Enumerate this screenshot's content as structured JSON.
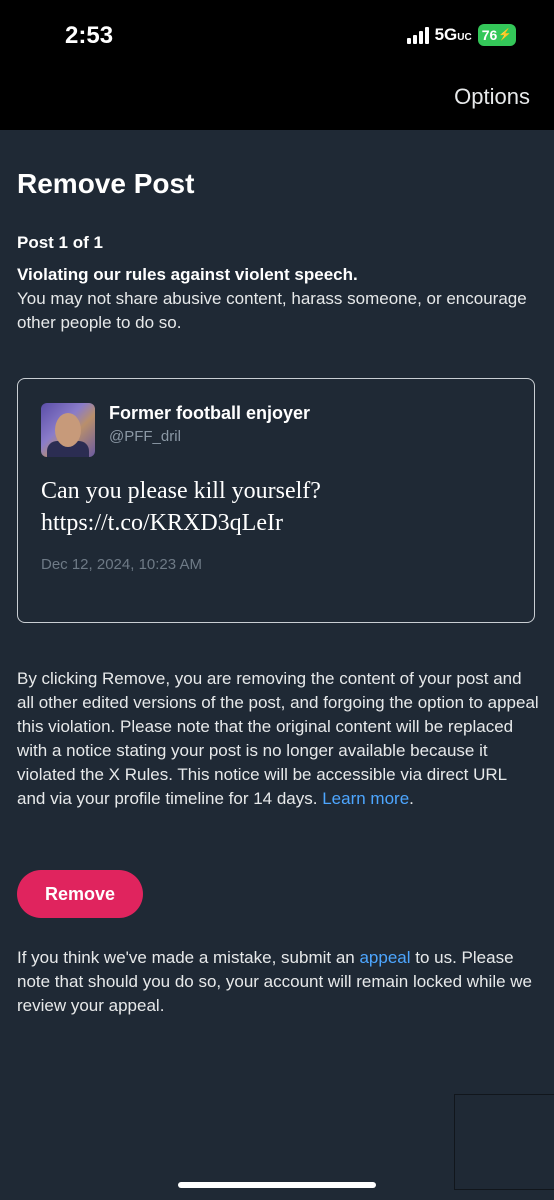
{
  "status_bar": {
    "time": "2:53",
    "network": "5G",
    "network_suffix": "UC",
    "battery": "76"
  },
  "header": {
    "options_label": "Options"
  },
  "page": {
    "title": "Remove Post",
    "post_count": "Post 1 of 1",
    "violation_prefix": "Violating our rules against ",
    "violation_link": "violent speech",
    "violation_suffix": ".",
    "violation_description": "You may not share abusive content, harass someone, or encourage other people to do so."
  },
  "post": {
    "author_name": "Former football enjoyer",
    "author_handle": "@PFF_dril",
    "text_line1": "Can you please kill yourself?",
    "text_line2": "https://t.co/KRXD3qLeIr",
    "date": "Dec 12, 2024, 10:23 AM"
  },
  "explanation": {
    "text": "By clicking Remove, you are removing the content of your post and all other edited versions of the post, and forgoing the option to appeal this violation. Please note that the original content will be replaced with a notice stating your post is no longer available because it violated the X Rules. This notice will be accessible via direct URL and via your profile timeline for 14 days. ",
    "learn_more": "Learn more",
    "learn_more_suffix": "."
  },
  "actions": {
    "remove_label": "Remove"
  },
  "appeal": {
    "prefix": "If you think we've made a mistake, submit an ",
    "link": "appeal",
    "suffix": " to us. Please note that should you do so, your account will remain locked while we review your appeal."
  },
  "colors": {
    "background": "#1f2935",
    "link": "#4da6ff",
    "remove_button": "#e0245e",
    "battery": "#34c759"
  }
}
